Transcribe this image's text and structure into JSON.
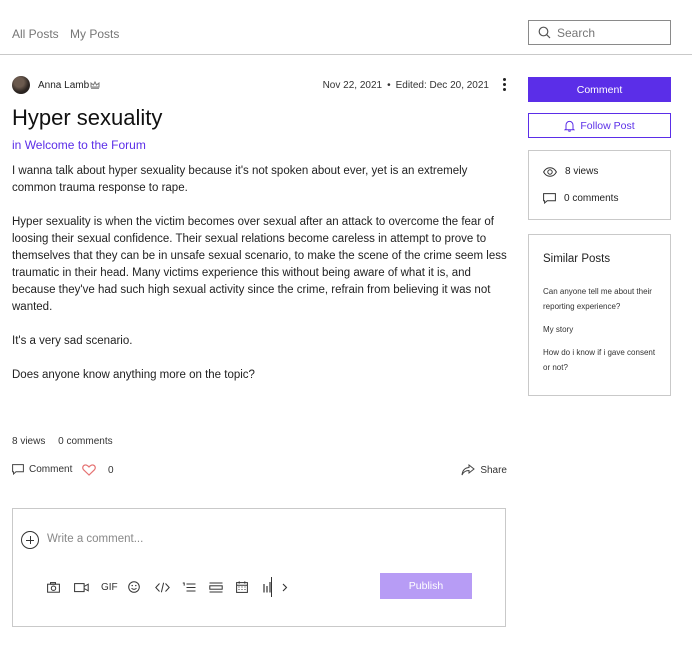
{
  "nav": {
    "all_posts": "All Posts",
    "my_posts": "My Posts",
    "search_placeholder": "Search"
  },
  "post": {
    "author": "Anna Lamb",
    "date": "Nov 22, 2021",
    "edited": "Edited: Dec 20, 2021",
    "title": "Hyper sexuality",
    "category_prefix": "in",
    "category": "Welcome to the Forum",
    "paragraphs": [
      "I wanna talk about hyper sexuality because it's not spoken about ever, yet is an extremely common trauma response to rape.",
      "Hyper sexuality is when the victim becomes over sexual after an attack to overcome the fear of loosing their sexual confidence. Their sexual relations become careless in attempt to prove to themselves that they can be in unsafe sexual scenario, to make the scene of the crime seem less traumatic in their head. Many victims experience this without being aware of what it is, and because they've had such high sexual activity since the crime, refrain from believing it was not wanted.",
      "It's a very sad scenario.",
      "Does anyone know anything more on the topic?"
    ],
    "views": "8 views",
    "comments": "0 comments"
  },
  "actions": {
    "comment": "Comment",
    "likes": "0",
    "share": "Share"
  },
  "comment_box": {
    "placeholder": "Write a comment...",
    "publish": "Publish",
    "gif_label": "GIF"
  },
  "sidebar": {
    "comment_button": "Comment",
    "follow_button": "Follow Post",
    "views": "8 views",
    "comments": "0 comments",
    "similar_title": "Similar Posts",
    "similar_posts": [
      "Can anyone tell me about their reporting experience?",
      "My story",
      "How do i know if i gave consent or not?"
    ]
  },
  "colors": {
    "accent": "#5b2ee8",
    "publish_disabled": "#b79cf5",
    "like_heart": "#e57373"
  },
  "icons": {
    "search": "search-icon",
    "crown": "crown-icon",
    "more": "more-icon",
    "comment": "comment-icon",
    "heart": "heart-icon",
    "share": "share-icon",
    "bell": "bell-icon",
    "eye": "eye-icon"
  }
}
